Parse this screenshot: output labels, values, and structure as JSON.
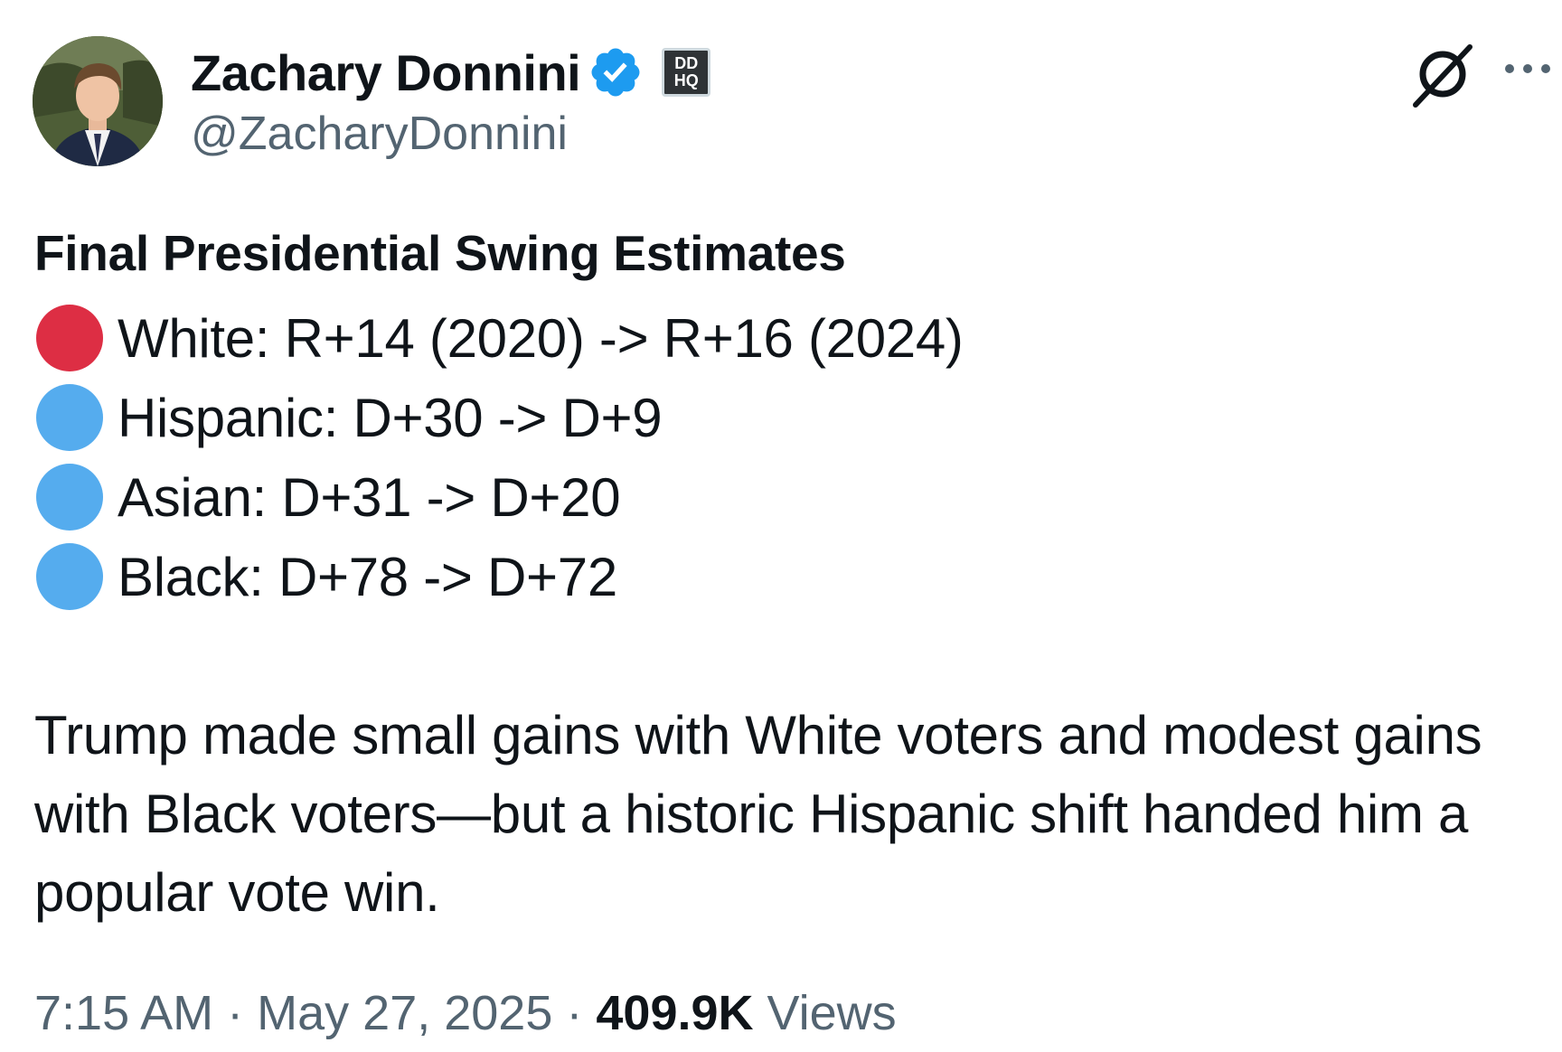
{
  "author": {
    "display_name": "Zachary Donnini",
    "handle": "@ZacharyDonnini",
    "verified_icon": "verified-badge-icon",
    "affiliation_badge": [
      "DD",
      "HQ"
    ],
    "affiliation_badge_icon": "ddhq-affiliate-badge"
  },
  "header_actions": {
    "grok_icon": "grok-icon",
    "more_icon": "more-horizontal-icon"
  },
  "post": {
    "heading": "Final Presidential Swing Estimates",
    "swing_rows": [
      {
        "color": "#dd2e44",
        "icon": "red-circle",
        "text": "White: R+14 (2020) -> R+16 (2024)"
      },
      {
        "color": "#55acee",
        "icon": "blue-circle",
        "text": "Hispanic: D+30 -> D+9"
      },
      {
        "color": "#55acee",
        "icon": "blue-circle",
        "text": "Asian: D+31 -> D+20"
      },
      {
        "color": "#55acee",
        "icon": "blue-circle",
        "text": "Black: D+78 -> D+72"
      }
    ],
    "body": "Trump made small gains with White voters and modest gains with Black voters—but a historic Hispanic shift handed him a popular vote win."
  },
  "meta": {
    "time": "7:15 AM",
    "separator": "·",
    "date": "May 27, 2025",
    "views_count": "409.9K",
    "views_label": "Views"
  },
  "colors": {
    "text_primary": "#0f1419",
    "text_secondary": "#536471",
    "verified_blue": "#1d9bf0"
  }
}
